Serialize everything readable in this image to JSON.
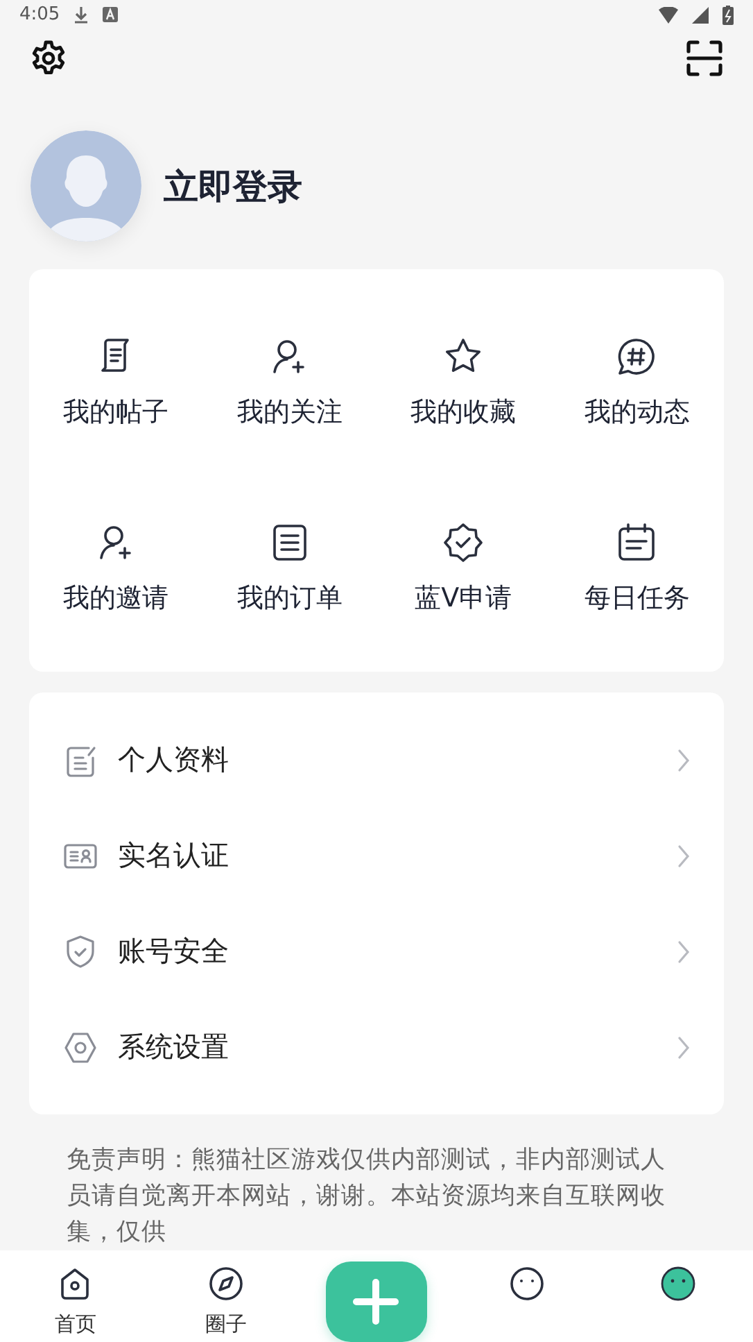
{
  "status_bar": {
    "time": "4:05"
  },
  "profile": {
    "login_label": "立即登录"
  },
  "shortcuts": [
    {
      "label": "我的帖子"
    },
    {
      "label": "我的关注"
    },
    {
      "label": "我的收藏"
    },
    {
      "label": "我的动态"
    },
    {
      "label": "我的邀请"
    },
    {
      "label": "我的订单"
    },
    {
      "label": "蓝V申请"
    },
    {
      "label": "每日任务"
    }
  ],
  "menu": [
    {
      "label": "个人资料"
    },
    {
      "label": "实名认证"
    },
    {
      "label": "账号安全"
    },
    {
      "label": "系统设置"
    }
  ],
  "disclaimer": "免责声明：熊猫社区游戏仅供内部测试，非内部测试人员请自觉离开本网站，谢谢。本站资源均来自互联网收集，仅供",
  "bottom_nav": [
    {
      "kind": "tab",
      "label": "首页",
      "selected": false
    },
    {
      "kind": "tab",
      "label": "圈子",
      "selected": false
    },
    {
      "kind": "add"
    },
    {
      "kind": "tab",
      "selected": false
    },
    {
      "kind": "tab",
      "selected": true
    }
  ]
}
